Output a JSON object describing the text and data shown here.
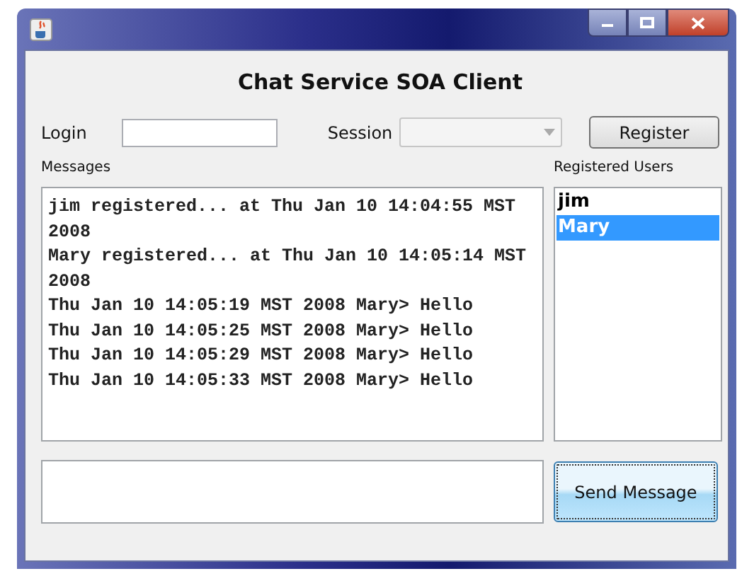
{
  "window": {
    "title": "Chat Service SOA Client"
  },
  "login": {
    "label": "Login"
  },
  "session": {
    "label": "Session",
    "disabled": true
  },
  "register_button": "Register",
  "messages": {
    "label": "Messages",
    "lines": [
      "jim registered... at Thu Jan 10 14:04:55 MST 2008",
      "Mary registered... at Thu Jan 10 14:05:14 MST 2008",
      "Thu Jan 10 14:05:19 MST 2008 Mary> Hello",
      "Thu Jan 10 14:05:25 MST 2008 Mary> Hello",
      "Thu Jan 10 14:05:29 MST 2008 Mary> Hello",
      "Thu Jan 10 14:05:33 MST 2008 Mary> Hello"
    ]
  },
  "users": {
    "label": "Registered Users",
    "items": [
      {
        "name": "jim",
        "selected": false
      },
      {
        "name": "Mary",
        "selected": true
      }
    ]
  },
  "send_button": "Send Message"
}
